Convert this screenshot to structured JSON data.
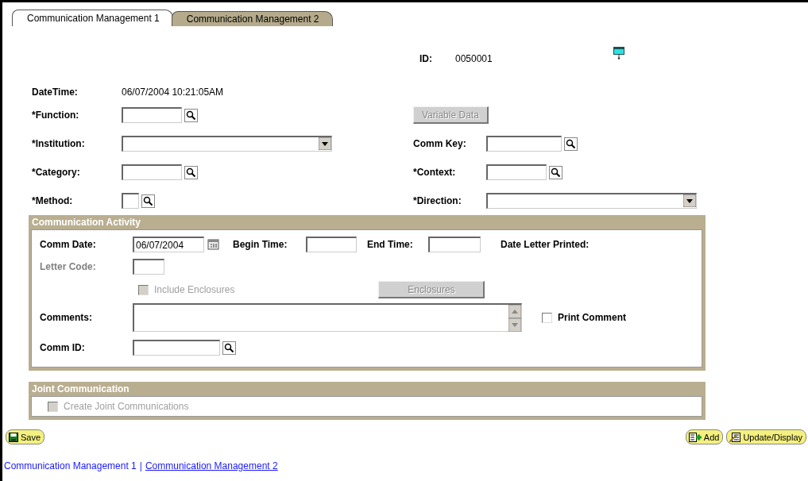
{
  "tabs": [
    {
      "label": "Communication Management 1",
      "selected": true
    },
    {
      "label": "Communication Management 2",
      "selected": false
    }
  ],
  "id": {
    "label": "ID:",
    "value": "0050001"
  },
  "datetime": {
    "label": "DateTime:",
    "value": "06/07/2004 10:21:05AM"
  },
  "left_fields": [
    {
      "label": "*Function:",
      "kind": "lookup"
    },
    {
      "label": "*Institution:",
      "kind": "dropdown"
    },
    {
      "label": "*Category:",
      "kind": "lookup"
    },
    {
      "label": "*Method:",
      "kind": "lookup"
    }
  ],
  "right_fields": [
    {
      "label": "Variable Data",
      "kind": "button",
      "disabled": true
    },
    {
      "label": "Comm Key:",
      "kind": "lookup"
    },
    {
      "label": "*Context:",
      "kind": "lookup"
    },
    {
      "label": "*Direction:",
      "kind": "dropdown"
    }
  ],
  "activity": {
    "title": "Communication Activity",
    "comm_date": {
      "label": "Comm Date:",
      "value": "06/07/2004"
    },
    "begin_time": {
      "label": "Begin Time:"
    },
    "end_time": {
      "label": "End Time:"
    },
    "date_letter_printed": {
      "label": "Date Letter Printed:"
    },
    "letter_code": {
      "label": "Letter Code:",
      "disabled": true
    },
    "include_enclosures": {
      "label": "Include Enclosures",
      "checked": false,
      "disabled": true
    },
    "enclosures_button": {
      "label": "Enclosures",
      "disabled": true
    },
    "comments": {
      "label": "Comments:"
    },
    "print_comment": {
      "label": "Print Comment",
      "checked": false,
      "disabled": false
    },
    "comm_id": {
      "label": "Comm ID:"
    }
  },
  "joint": {
    "title": "Joint Communication",
    "create_joint": {
      "label": "Create Joint Communications",
      "checked": false,
      "disabled": true
    }
  },
  "buttons": {
    "save": "Save",
    "add": "Add",
    "update": "Update/Display"
  },
  "links": [
    {
      "label": "Communication Management 1",
      "selected": true
    },
    {
      "label": "Communication Management 2",
      "selected": false
    }
  ],
  "link_separator": "|"
}
